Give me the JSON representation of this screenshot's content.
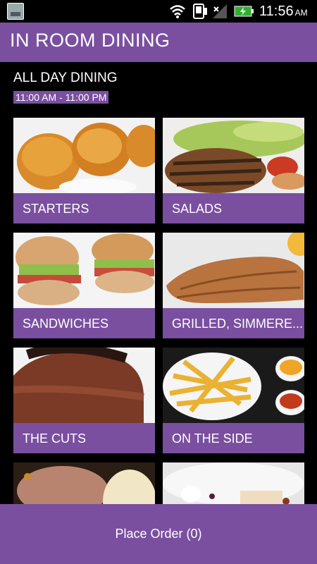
{
  "status_bar": {
    "time": "11:56",
    "ampm": "AM",
    "icons": [
      "app-thumbnail-icon",
      "wifi-icon",
      "phone-icon",
      "signal-icon",
      "battery-icon"
    ]
  },
  "header": {
    "title": "IN ROOM DINING"
  },
  "section": {
    "title": "ALL DAY DINING",
    "hours": "11:00 AM - 11:00 PM"
  },
  "categories": [
    {
      "label": "STARTERS"
    },
    {
      "label": "SALADS"
    },
    {
      "label": "SANDWICHES"
    },
    {
      "label": "GRILLED, SIMMERE..."
    },
    {
      "label": "THE CUTS"
    },
    {
      "label": "ON THE SIDE"
    },
    {
      "label": ""
    },
    {
      "label": ""
    }
  ],
  "footer": {
    "order_button": "Place Order (0)"
  },
  "colors": {
    "accent": "#7a4fa0",
    "background": "#000000"
  }
}
